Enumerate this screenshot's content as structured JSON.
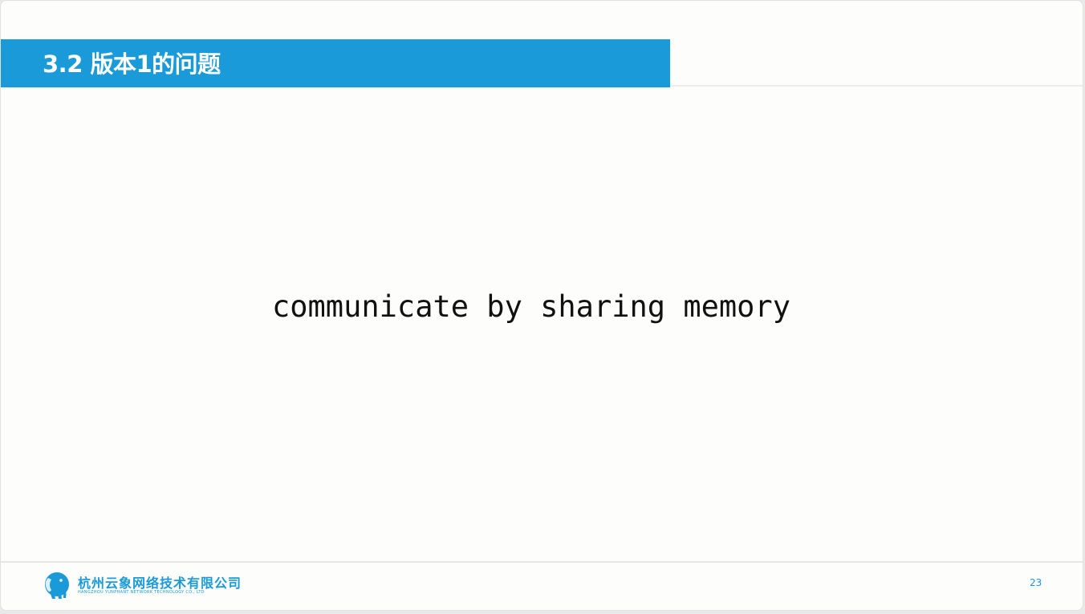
{
  "slide": {
    "title": "3.2 版本1的问题",
    "body": "communicate by sharing memory",
    "page_number": "23"
  },
  "footer": {
    "company_name": "杭州云象网络技术有限公司",
    "company_name_en": "HANGZHOU YUNPHANT NETWORK TECHNOLOGY CO., LTD",
    "logo_icon": "elephant-logo-icon"
  },
  "colors": {
    "accent": "#1a9ad9",
    "background": "#fdfdfc",
    "text": "#111111"
  }
}
